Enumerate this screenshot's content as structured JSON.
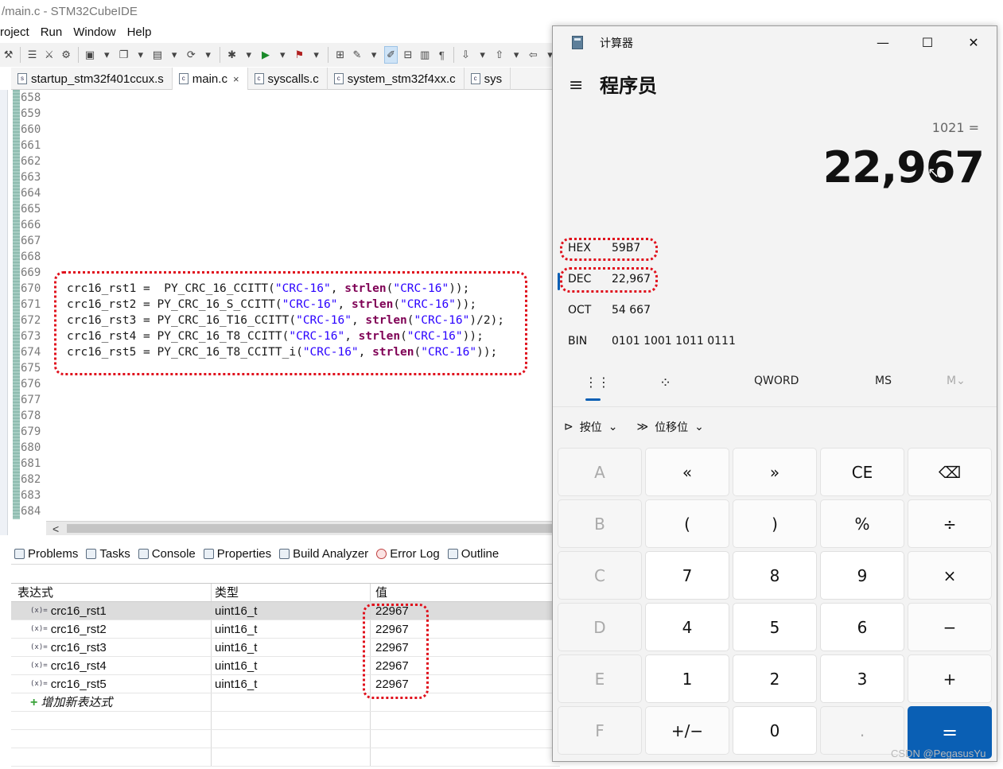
{
  "ide": {
    "title": "/main.c - STM32CubeIDE",
    "menu": [
      "roject",
      "Run",
      "Window",
      "Help"
    ],
    "tabs": [
      {
        "label": "startup_stm32f401ccux.s",
        "icon": "s",
        "active": false
      },
      {
        "label": "main.c",
        "icon": "c",
        "active": true,
        "close": "×"
      },
      {
        "label": "syscalls.c",
        "icon": "c",
        "active": false
      },
      {
        "label": "system_stm32f4xx.c",
        "icon": "c",
        "active": false
      },
      {
        "label": "sys",
        "icon": "c",
        "active": false
      }
    ],
    "line_numbers": [
      "658",
      "659",
      "660",
      "661",
      "662",
      "663",
      "664",
      "665",
      "666",
      "667",
      "668",
      "669",
      "670",
      "671",
      "672",
      "673",
      "674",
      "675",
      "676",
      "677",
      "678",
      "679",
      "680",
      "681",
      "682",
      "683",
      "684"
    ],
    "code_lines": [
      {
        "pre": "crc16_rst1 =  PY_CRC_16_CCITT(",
        "s1": "\"CRC-16\"",
        "mid": ", ",
        "kw": "strlen",
        "p": "(",
        "s2": "\"CRC-16\"",
        "post": "));"
      },
      {
        "pre": "crc16_rst2 = PY_CRC_16_S_CCITT(",
        "s1": "\"CRC-16\"",
        "mid": ", ",
        "kw": "strlen",
        "p": "(",
        "s2": "\"CRC-16\"",
        "post": "));"
      },
      {
        "pre": "crc16_rst3 = PY_CRC_16_T16_CCITT(",
        "s1": "\"CRC-16\"",
        "mid": ", ",
        "kw": "strlen",
        "p": "(",
        "s2": "\"CRC-16\"",
        "post": ")/2);"
      },
      {
        "pre": "crc16_rst4 = PY_CRC_16_T8_CCITT(",
        "s1": "\"CRC-16\"",
        "mid": ", ",
        "kw": "strlen",
        "p": "(",
        "s2": "\"CRC-16\"",
        "post": "));"
      },
      {
        "pre": "crc16_rst5 = PY_CRC_16_T8_CCITT_i(",
        "s1": "\"CRC-16\"",
        "mid": ", ",
        "kw": "strlen",
        "p": "(",
        "s2": "\"CRC-16\"",
        "post": "));"
      }
    ],
    "views": [
      "Problems",
      "Tasks",
      "Console",
      "Properties",
      "Build Analyzer",
      "Error Log",
      "Outline"
    ],
    "expressions": {
      "headers": [
        "表达式",
        "类型",
        "值"
      ],
      "rows": [
        {
          "icon": "(x)=",
          "name": "crc16_rst1",
          "type": "uint16_t",
          "value": "22967"
        },
        {
          "icon": "(x)=",
          "name": "crc16_rst2",
          "type": "uint16_t",
          "value": "22967"
        },
        {
          "icon": "(x)=",
          "name": "crc16_rst3",
          "type": "uint16_t",
          "value": "22967"
        },
        {
          "icon": "(x)=",
          "name": "crc16_rst4",
          "type": "uint16_t",
          "value": "22967"
        },
        {
          "icon": "(x)=",
          "name": "crc16_rst5",
          "type": "uint16_t",
          "value": "22967"
        }
      ],
      "add_label": "增加新表达式",
      "add_icon": "+"
    }
  },
  "calculator": {
    "title": "计算器",
    "mode": "程序员",
    "hamburger": "≡",
    "window_buttons": {
      "minimize": "—",
      "maximize": "☐",
      "close": "✕"
    },
    "expression": "1021 =",
    "display": "22,967",
    "radix": [
      {
        "label": "HEX",
        "value": "59B7"
      },
      {
        "label": "DEC",
        "value": "22,967"
      },
      {
        "label": "OCT",
        "value": "54 667"
      },
      {
        "label": "BIN",
        "value": "0101 1001 1011 0111"
      }
    ],
    "tabs": {
      "keypad_icon": "⋮⋮",
      "bits_icon": "⁘",
      "word": "QWORD",
      "ms": "MS",
      "mv": "M⌄"
    },
    "ops": {
      "bitwise": "按位",
      "bitshift": "位移位",
      "chevron": "⌄"
    },
    "keys": [
      [
        "A",
        "«",
        "»",
        "CE",
        "⌫"
      ],
      [
        "B",
        "(",
        ")",
        "%",
        "÷"
      ],
      [
        "C",
        "7",
        "8",
        "9",
        "×"
      ],
      [
        "D",
        "4",
        "5",
        "6",
        "−"
      ],
      [
        "E",
        "1",
        "2",
        "3",
        "+"
      ],
      [
        "F",
        "+/−",
        "0",
        ".",
        "="
      ]
    ]
  },
  "watermark": "CSDN @PegasusYu"
}
